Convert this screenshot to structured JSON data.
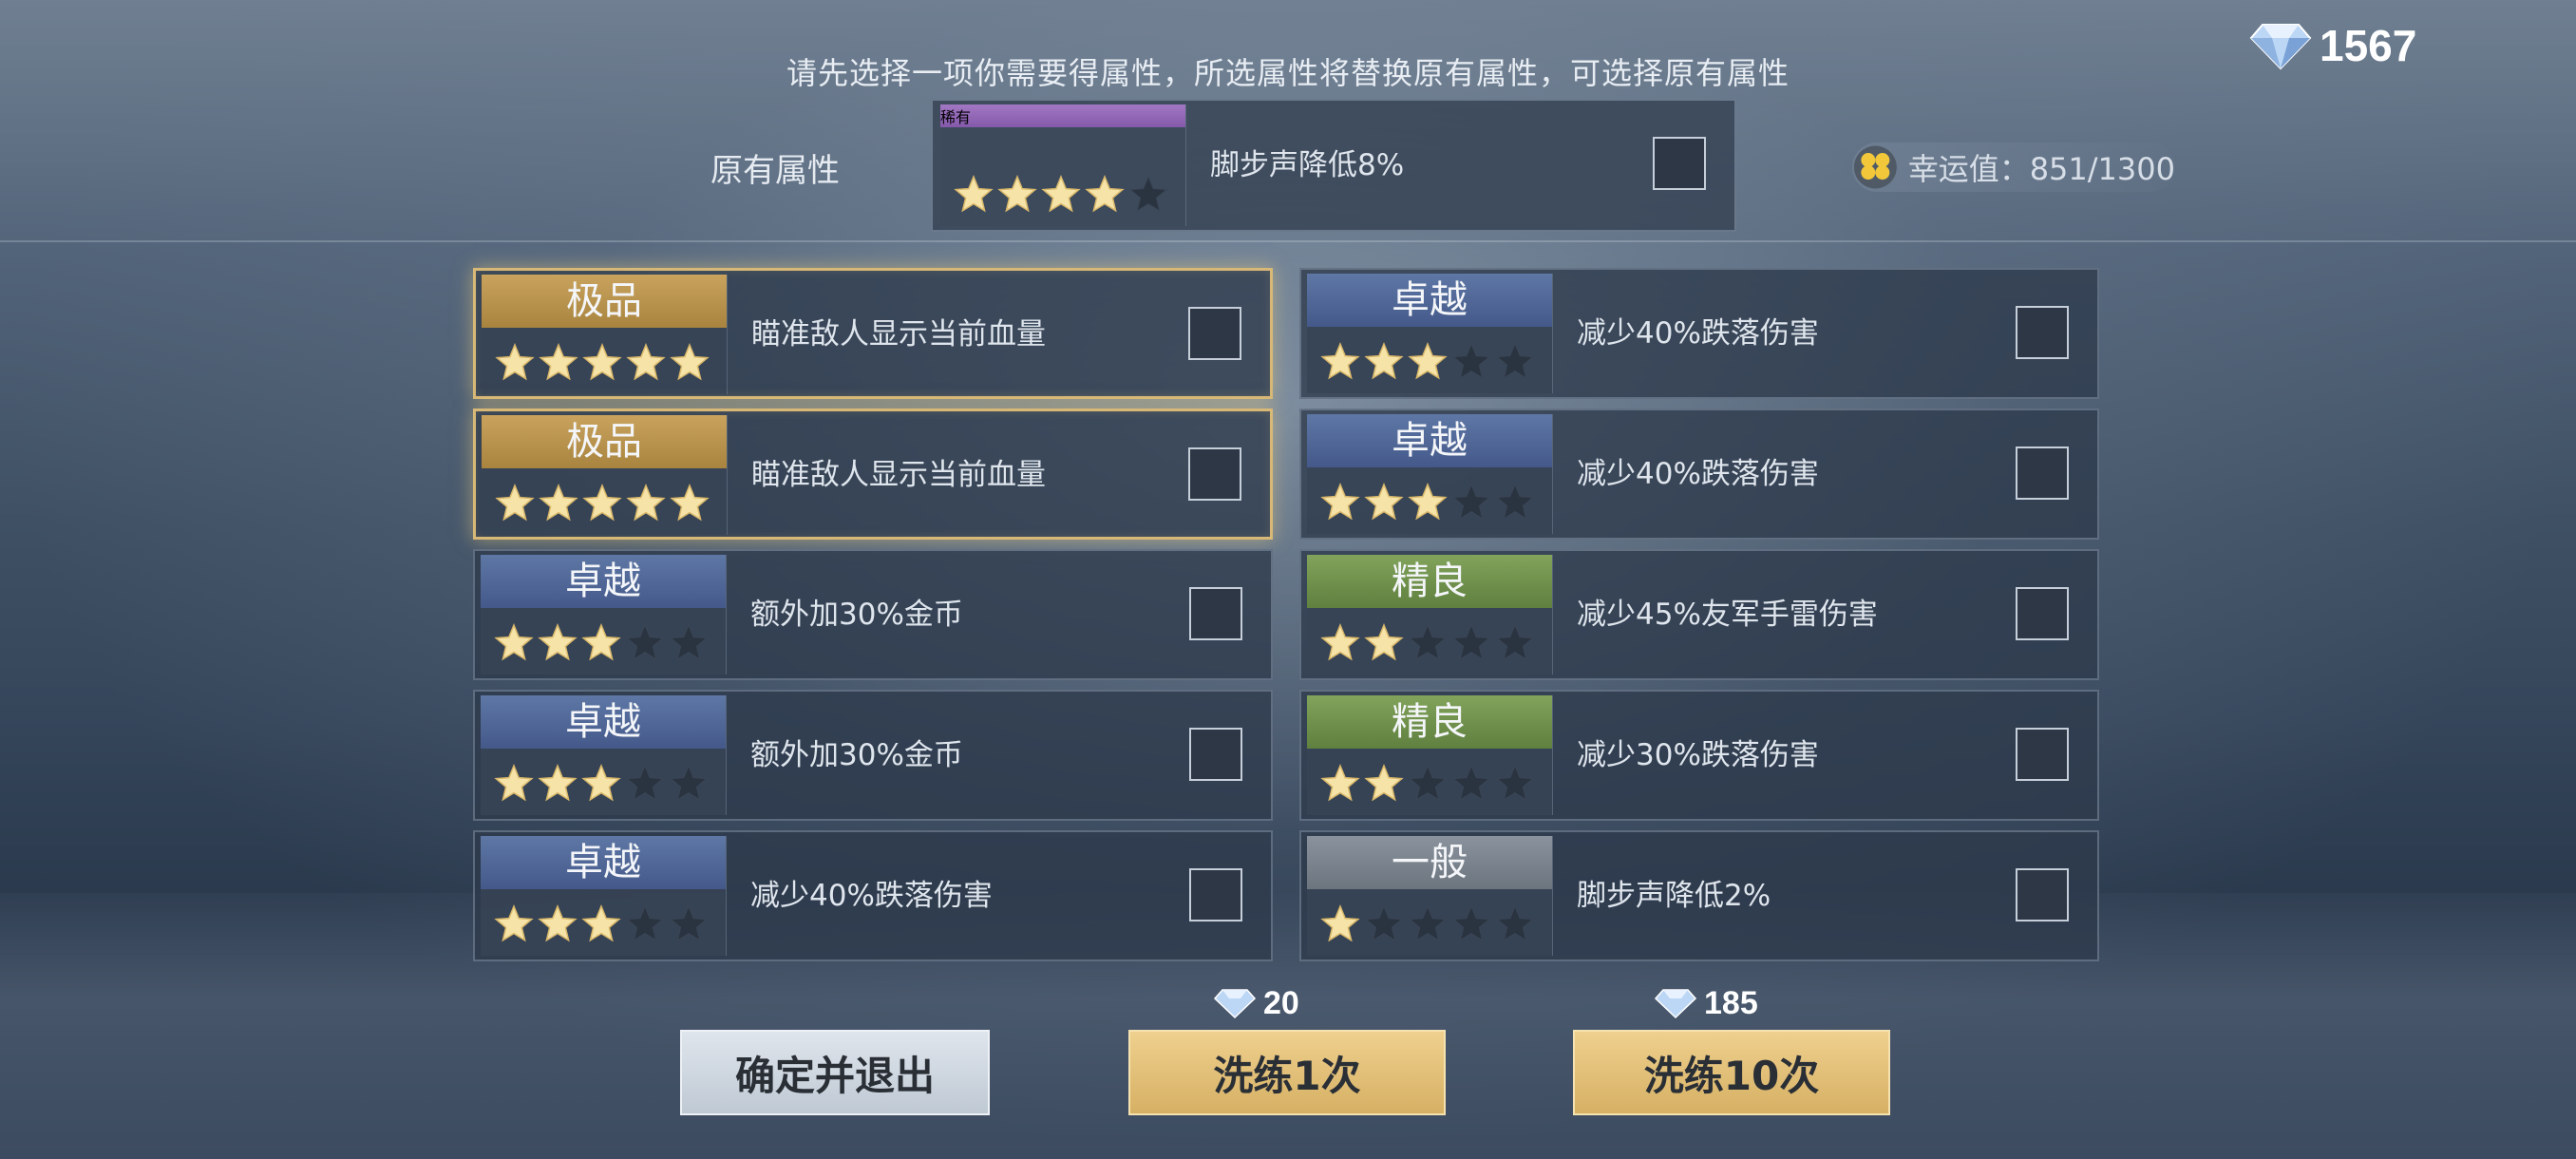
{
  "header": {
    "instruction": "请先选择一项你需要得属性，所选属性将替换原有属性，可选择原有属性",
    "currency_amount": "1567",
    "currency_icon": "diamond-icon"
  },
  "original": {
    "label": "原有属性",
    "grade": "稀有",
    "grade_color": "#9a6bbd",
    "stars": 4,
    "description": "脚步声降低8%"
  },
  "luck": {
    "text": "幸运值：851/1300",
    "icon": "clover-icon"
  },
  "options": [
    {
      "grade": "极品",
      "stars": 5,
      "description": "瞄准敌人显示当前血量",
      "highlight": true
    },
    {
      "grade": "卓越",
      "stars": 3,
      "description": "减少40%跌落伤害",
      "highlight": false
    },
    {
      "grade": "极品",
      "stars": 5,
      "description": "瞄准敌人显示当前血量",
      "highlight": true
    },
    {
      "grade": "卓越",
      "stars": 3,
      "description": "减少40%跌落伤害",
      "highlight": false
    },
    {
      "grade": "卓越",
      "stars": 3,
      "description": "额外加30%金币",
      "highlight": false
    },
    {
      "grade": "精良",
      "stars": 2,
      "description": "减少45%友军手雷伤害",
      "highlight": false
    },
    {
      "grade": "卓越",
      "stars": 3,
      "description": "额外加30%金币",
      "highlight": false
    },
    {
      "grade": "精良",
      "stars": 2,
      "description": "减少30%跌落伤害",
      "highlight": false
    },
    {
      "grade": "卓越",
      "stars": 3,
      "description": "减少40%跌落伤害",
      "highlight": false
    },
    {
      "grade": "一般",
      "stars": 1,
      "description": "脚步声降低2%",
      "highlight": false
    }
  ],
  "grade_colors": {
    "极品": "#c9a35e",
    "卓越": "#5e77a5",
    "精良": "#82a35b",
    "一般": "#8a939d",
    "稀有": "#a278c4"
  },
  "buttons": {
    "confirm": "确定并退出",
    "once": "洗练1次",
    "once_cost": "20",
    "ten": "洗练10次",
    "ten_cost": "185"
  }
}
